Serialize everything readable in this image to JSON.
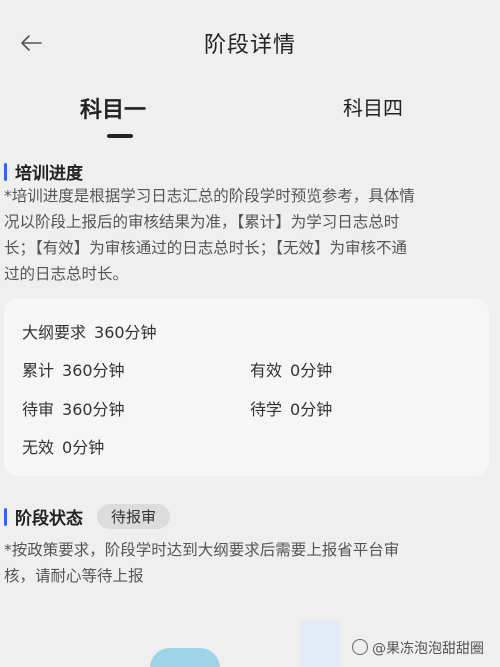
{
  "header": {
    "title": "阶段详情",
    "back_icon": "arrow-left-icon"
  },
  "tabs": [
    {
      "label": "科目一",
      "active": true
    },
    {
      "label": "科目四",
      "active": false
    }
  ],
  "progress": {
    "title": "培训进度",
    "accent_color": "#2f66ff",
    "notice_lines": [
      "*培训进度是根据学习日志汇总的阶段学时预览参考，具体情",
      "况以阶段上报后的审核结果为准，【累计】为学习日志总时",
      "长；【有效】为审核通过的日志总时长；【无效】为审核不通",
      "过的日志总时长。"
    ],
    "stats": {
      "outline": {
        "label": "大纲要求",
        "value": "360分钟"
      },
      "total": {
        "label": "累计",
        "value": "360分钟"
      },
      "valid": {
        "label": "有效",
        "value": "0分钟"
      },
      "pending_review": {
        "label": "待审",
        "value": "360分钟"
      },
      "pending_study": {
        "label": "待学",
        "value": "0分钟"
      },
      "invalid": {
        "label": "无效",
        "value": "0分钟"
      }
    }
  },
  "stage_status": {
    "title": "阶段状态",
    "badge": "待报审",
    "notice_lines": [
      "*按政策要求，阶段学时达到大纲要求后需要上报省平台审",
      "核，请耐心等待上报"
    ]
  },
  "watermark": "@果冻泡泡甜甜圈"
}
